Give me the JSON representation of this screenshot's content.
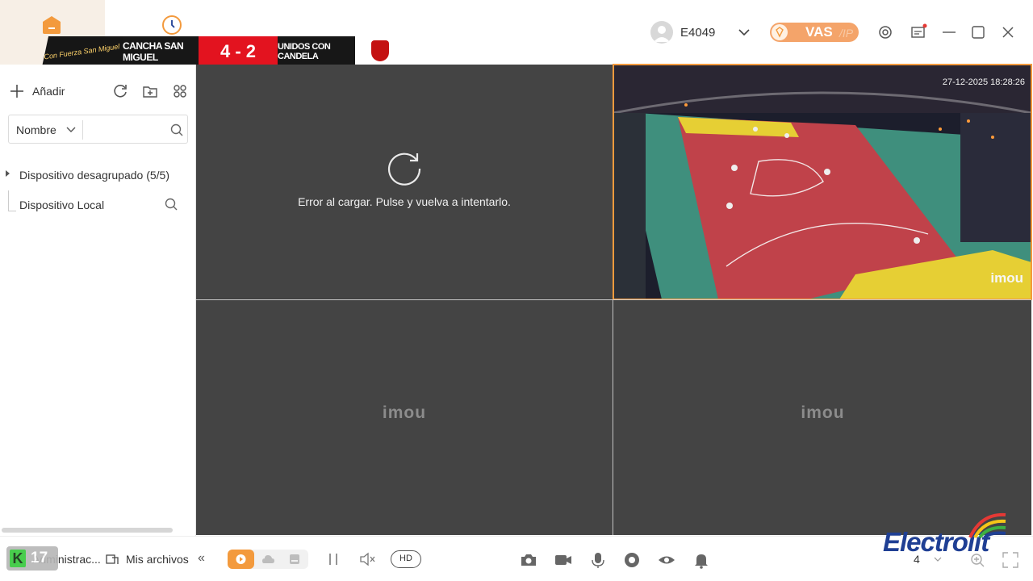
{
  "titlebar": {
    "username": "E4049",
    "vas_label": "VAS",
    "vas_suffix": "/IP",
    "scoreboard": {
      "team_home": "CANCHA SAN MIGUEL",
      "score": "4 - 2",
      "team_away": "UNIDOS CON CANDELA",
      "home_logo_text": "Con Fuerza San Miguel"
    }
  },
  "sidebar": {
    "add_label": "Añadir",
    "filter_label": "Nombre",
    "search_placeholder": "",
    "tree": [
      {
        "label": "Dispositivo desagrupado (5/5)"
      },
      {
        "label": "Dispositivo Local"
      }
    ]
  },
  "grid": {
    "error_message": "Error al cargar. Pulse y vuelva a intentarlo.",
    "live_timestamp": "27-12-2025 18:28:26",
    "watermark": "imou"
  },
  "bottombar": {
    "overlay_badge_number": "17",
    "admin_label": "Administrac...",
    "files_label": "Mis archivos",
    "collapse_glyph": "«",
    "hd_label": "HD",
    "layout_value": "4",
    "brand": "Electrolit"
  },
  "colors": {
    "accent": "#f39a3d",
    "vas": "#f4a46a",
    "video_bg": "#444444",
    "brand": "#1f3f94"
  },
  "icons": [
    "home-icon",
    "clock-icon",
    "chevron-down-icon",
    "gear-icon",
    "message-icon",
    "minimize-icon",
    "maximize-icon",
    "close-icon",
    "plus-icon",
    "refresh-icon",
    "add-folder-icon",
    "grid-icon",
    "search-icon",
    "folder-icon",
    "play-icon",
    "cloud-icon",
    "storage-icon",
    "pause-icon",
    "mute-icon",
    "camera-icon",
    "record-icon",
    "microphone-icon",
    "ptz-icon",
    "eye-icon",
    "bell-icon",
    "zoom-icon",
    "fullscreen-icon"
  ]
}
